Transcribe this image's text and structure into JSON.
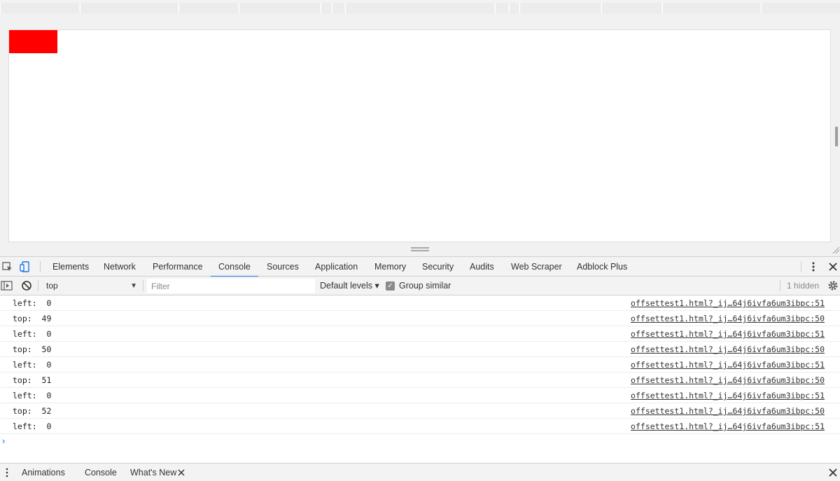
{
  "devtools": {
    "tabs": [
      "Elements",
      "Network",
      "Performance",
      "Console",
      "Sources",
      "Application",
      "Memory",
      "Security",
      "Audits",
      "Web Scraper",
      "Adblock Plus"
    ],
    "active_tab": "Console",
    "more_icon": "more-vertical-icon",
    "close_icon": "close-icon"
  },
  "console_toolbar": {
    "context": "top",
    "filter_placeholder": "Filter",
    "levels": "Default levels ▾",
    "group_similar": "Group similar",
    "group_similar_checked": true,
    "hidden_count": "1 hidden"
  },
  "console_log": [
    {
      "message": "left:  0",
      "source": "offsettest1.html?_ij…64j6ivfa6um3ibpc:51"
    },
    {
      "message": "top:  49",
      "source": "offsettest1.html?_ij…64j6ivfa6um3ibpc:50"
    },
    {
      "message": "left:  0",
      "source": "offsettest1.html?_ij…64j6ivfa6um3ibpc:51"
    },
    {
      "message": "top:  50",
      "source": "offsettest1.html?_ij…64j6ivfa6um3ibpc:50"
    },
    {
      "message": "left:  0",
      "source": "offsettest1.html?_ij…64j6ivfa6um3ibpc:51"
    },
    {
      "message": "top:  51",
      "source": "offsettest1.html?_ij…64j6ivfa6um3ibpc:50"
    },
    {
      "message": "left:  0",
      "source": "offsettest1.html?_ij…64j6ivfa6um3ibpc:51"
    },
    {
      "message": "top:  52",
      "source": "offsettest1.html?_ij…64j6ivfa6um3ibpc:50"
    },
    {
      "message": "left:  0",
      "source": "offsettest1.html?_ij…64j6ivfa6um3ibpc:51"
    }
  ],
  "drawer": {
    "tabs": [
      "Animations",
      "Console",
      "What's New"
    ],
    "active_tab": "What's New"
  },
  "colors": {
    "red_box": "#ff0000",
    "active_tab_underline": "#1a73e8"
  }
}
